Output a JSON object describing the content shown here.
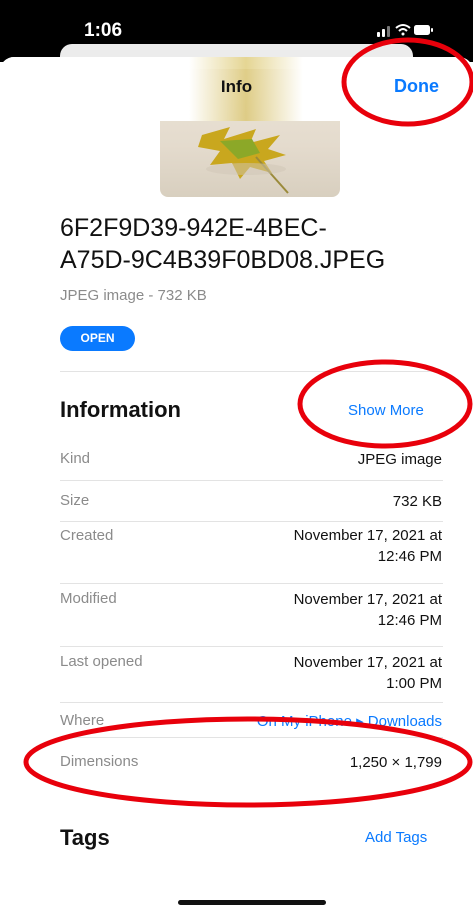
{
  "status_bar": {
    "time": "1:06"
  },
  "nav": {
    "title": "Info",
    "done_label": "Done"
  },
  "file": {
    "name_line1": "6F2F9D39-942E-4BEC-",
    "name_line2": "A75D-9C4B39F0BD08.JPEG",
    "subtitle": "JPEG image - 732 KB",
    "open_label": "OPEN"
  },
  "information": {
    "title": "Information",
    "show_more_label": "Show More",
    "rows": [
      {
        "label": "Kind",
        "value_line1": "JPEG image",
        "value_line2": ""
      },
      {
        "label": "Size",
        "value_line1": "732 KB",
        "value_line2": ""
      },
      {
        "label": "Created",
        "value_line1": "November 17, 2021 at",
        "value_line2": "12:46 PM"
      },
      {
        "label": "Modified",
        "value_line1": "November 17, 2021 at",
        "value_line2": "12:46 PM"
      },
      {
        "label": "Last opened",
        "value_line1": "November 17, 2021 at",
        "value_line2": "1:00 PM"
      },
      {
        "label": "Where",
        "value_line1": "On My iPhone ▸ Downloads",
        "value_line2": ""
      },
      {
        "label": "Dimensions",
        "value_line1": "1,250 × 1,799",
        "value_line2": ""
      }
    ]
  },
  "tags": {
    "title": "Tags",
    "add_label": "Add Tags"
  },
  "colors": {
    "accent": "#0a7aff",
    "annotation": "#e8000b"
  }
}
